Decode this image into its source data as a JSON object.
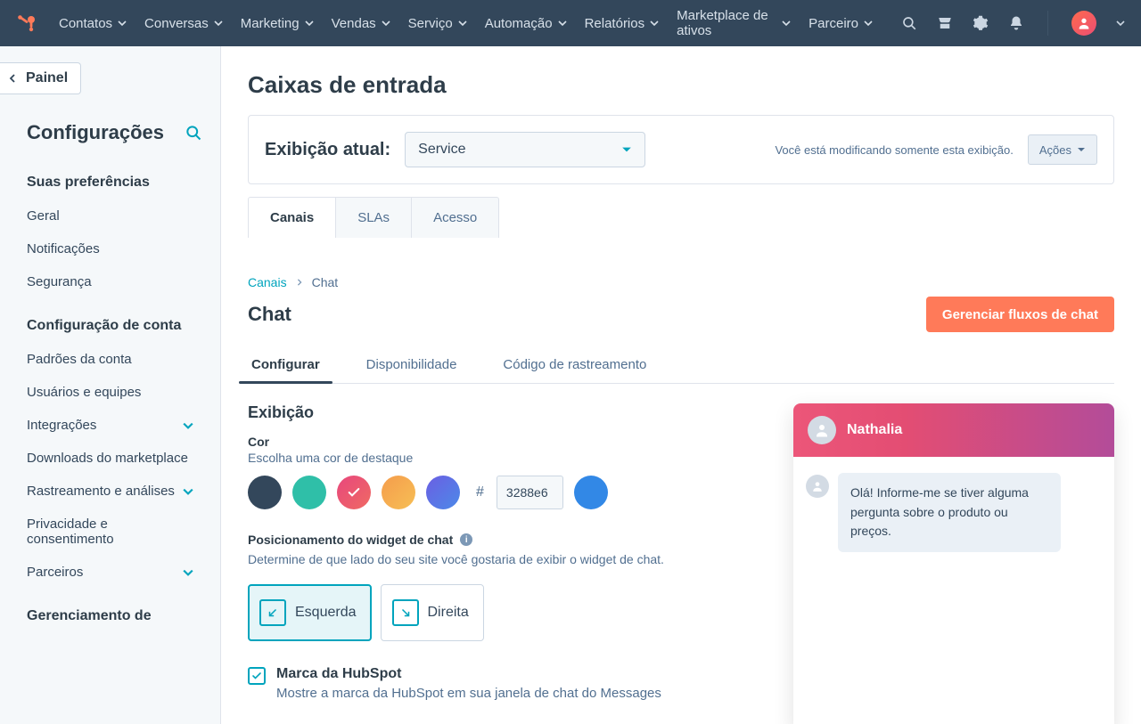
{
  "nav": {
    "items": [
      "Contatos",
      "Conversas",
      "Marketing",
      "Vendas",
      "Serviço",
      "Automação",
      "Relatórios",
      "Marketplace de ativos",
      "Parceiro"
    ]
  },
  "sidebar": {
    "back": "Painel",
    "title": "Configurações",
    "sections": [
      {
        "title": "Suas preferências",
        "items": [
          {
            "label": "Geral",
            "expandable": false
          },
          {
            "label": "Notificações",
            "expandable": false
          },
          {
            "label": "Segurança",
            "expandable": false
          }
        ]
      },
      {
        "title": "Configuração de conta",
        "items": [
          {
            "label": "Padrões da conta",
            "expandable": false
          },
          {
            "label": "Usuários e equipes",
            "expandable": false
          },
          {
            "label": "Integrações",
            "expandable": true
          },
          {
            "label": "Downloads do marketplace",
            "expandable": false
          },
          {
            "label": "Rastreamento e análises",
            "expandable": true
          },
          {
            "label": "Privacidade e consentimento",
            "expandable": false
          },
          {
            "label": "Parceiros",
            "expandable": true
          }
        ]
      },
      {
        "title": "Gerenciamento de",
        "items": []
      }
    ]
  },
  "page": {
    "title": "Caixas de entrada",
    "viewCard": {
      "label": "Exibição atual:",
      "value": "Service",
      "note": "Você está modificando somente esta exibição.",
      "actions": "Ações"
    },
    "tabs": [
      "Canais",
      "SLAs",
      "Acesso"
    ],
    "tabsActive": 0
  },
  "breadcrumb": {
    "root": "Canais",
    "leaf": "Chat"
  },
  "chat": {
    "title": "Chat",
    "manageBtn": "Gerenciar fluxos de chat",
    "subtabs": [
      "Configurar",
      "Disponibilidade",
      "Código de rastreamento"
    ],
    "subtabActive": 0,
    "display": {
      "heading": "Exibição",
      "colorLabel": "Cor",
      "colorHelp": "Escolha uma cor de destaque",
      "swatches": [
        "#33475b",
        "#2fbfa8",
        "#e8477d",
        "#f59c4c",
        "#6b5ee3"
      ],
      "swatchSelected": 2,
      "hex": "3288e6",
      "hexPreview": "#3288e6",
      "posLabel": "Posicionamento do widget de chat",
      "posHelp": "Determine de que lado do seu site você gostaria de exibir o widget de chat.",
      "posLeft": "Esquerda",
      "posRight": "Direita",
      "posSelected": "left",
      "brandTitle": "Marca da HubSpot",
      "brandHelp": "Mostre a marca da HubSpot em sua janela de chat do Messages"
    }
  },
  "preview": {
    "agent": "Nathalia",
    "greeting": "Olá! Informe-me se tiver alguma pergunta sobre o produto ou preços."
  }
}
